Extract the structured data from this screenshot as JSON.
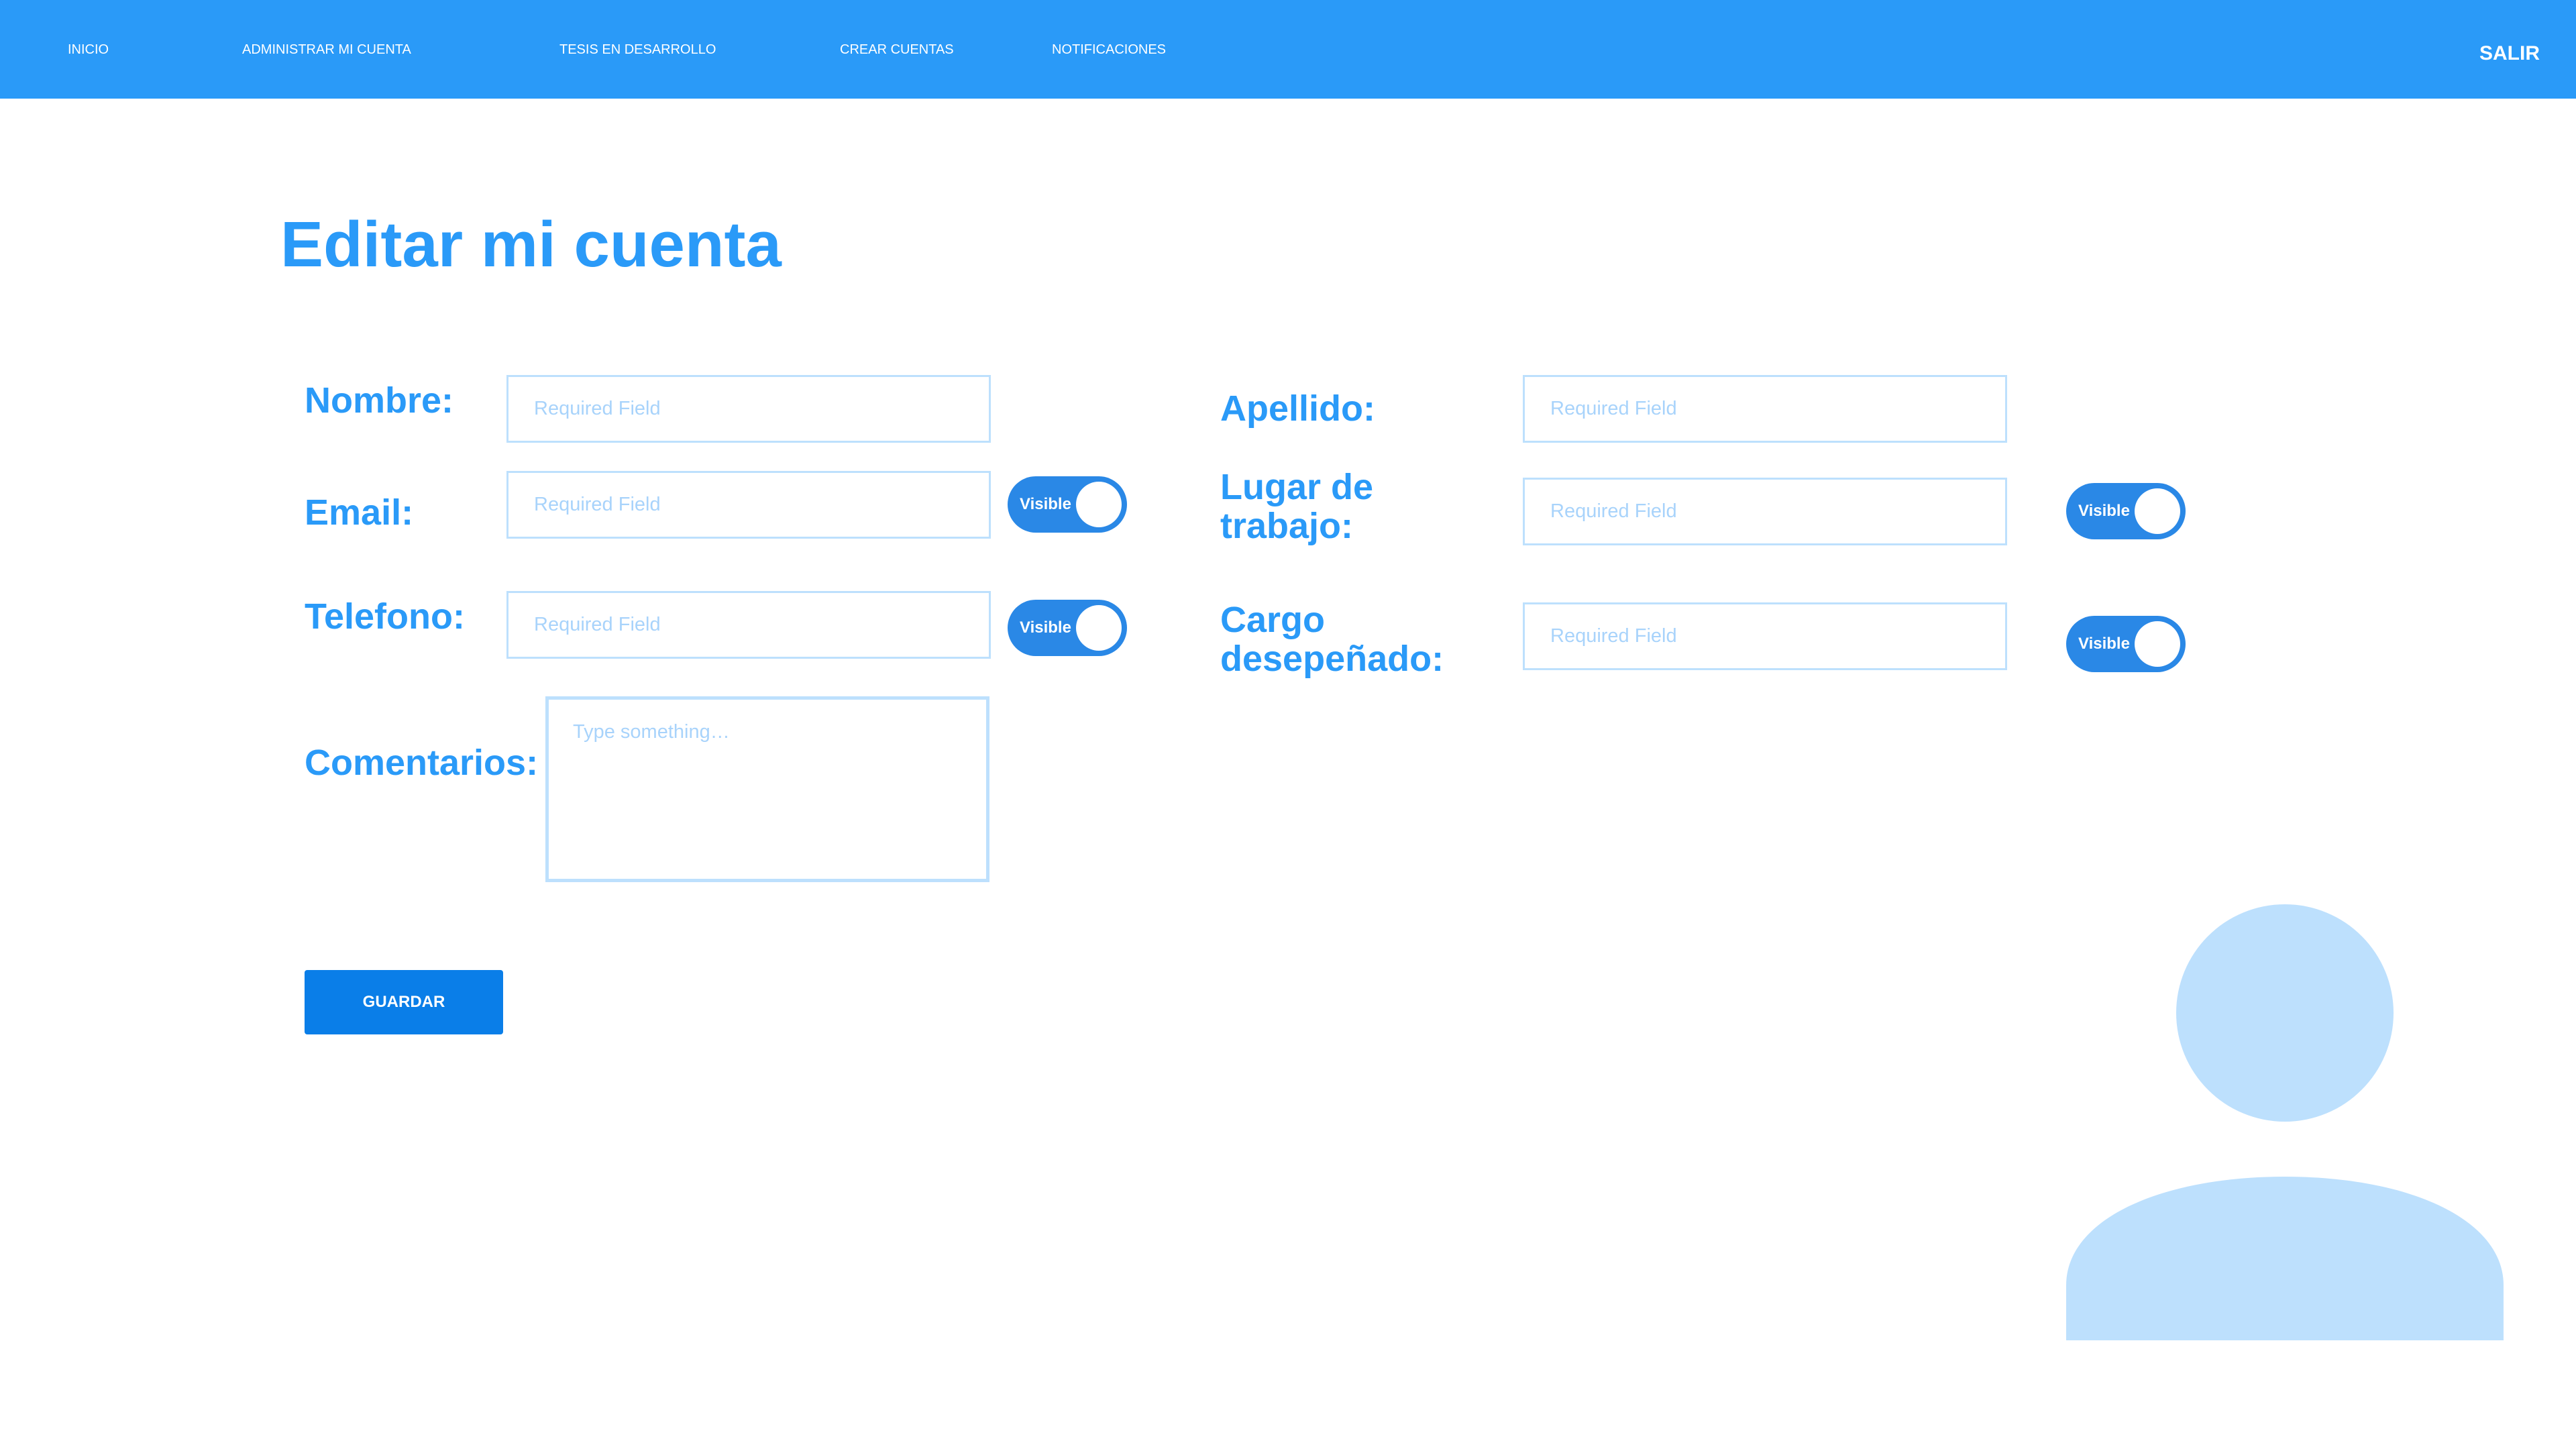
{
  "nav": {
    "items": [
      {
        "label": "INICIO"
      },
      {
        "label": "ADMINISTRAR MI CUENTA"
      },
      {
        "label": "TESIS EN DESARROLLO"
      },
      {
        "label": "CREAR CUENTAS"
      },
      {
        "label": "NOTIFICACIONES"
      }
    ],
    "logout_label": "SALIR"
  },
  "page": {
    "title": "Editar mi cuenta"
  },
  "form": {
    "nombre": {
      "label": "Nombre:",
      "placeholder": "Required Field",
      "value": ""
    },
    "apellido": {
      "label": "Apellido:",
      "placeholder": "Required Field",
      "value": ""
    },
    "email": {
      "label": "Email:",
      "placeholder": "Required Field",
      "value": "",
      "visibility": "Visible",
      "visible_on": true
    },
    "lugar_trabajo": {
      "label_line1": "Lugar de",
      "label_line2": "trabajo:",
      "placeholder": "Required Field",
      "value": "",
      "visibility": "Visible",
      "visible_on": true
    },
    "telefono": {
      "label": "Telefono:",
      "placeholder": "Required Field",
      "value": "",
      "visibility": "Visible",
      "visible_on": true
    },
    "cargo": {
      "label_line1": "Cargo",
      "label_line2": "desepeñado:",
      "placeholder": "Required Field",
      "value": "",
      "visibility": "Visible",
      "visible_on": true
    },
    "comentarios": {
      "label": "Comentarios:",
      "placeholder": "Type something…",
      "value": ""
    },
    "save_label": "GUARDAR"
  },
  "colors": {
    "primary": "#2a9af8",
    "button": "#0a7ee8",
    "field_border": "#bde0fd",
    "avatar": "#bde0fd"
  },
  "icons": {
    "avatar": "user-avatar-icon"
  }
}
